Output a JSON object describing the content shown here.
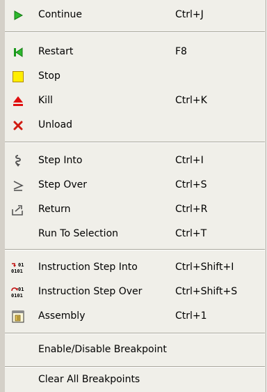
{
  "menu": {
    "items": [
      {
        "label": "Continue",
        "accel": "Ctrl+J",
        "icon": "play-icon"
      },
      {
        "label": "Restart",
        "accel": "F8",
        "icon": "restart-icon"
      },
      {
        "label": "Stop",
        "accel": "",
        "icon": "stop-icon"
      },
      {
        "label": "Kill",
        "accel": "Ctrl+K",
        "icon": "eject-icon"
      },
      {
        "label": "Unload",
        "accel": "",
        "icon": "unload-x-icon"
      },
      {
        "label": "Step Into",
        "accel": "Ctrl+I",
        "icon": "step-into-icon"
      },
      {
        "label": "Step Over",
        "accel": "Ctrl+S",
        "icon": "step-over-icon"
      },
      {
        "label": "Return",
        "accel": "Ctrl+R",
        "icon": "return-icon"
      },
      {
        "label": "Run To Selection",
        "accel": "Ctrl+T",
        "icon": ""
      },
      {
        "label": "Instruction Step Into",
        "accel": "Ctrl+Shift+I",
        "icon": "binary-step-into-icon"
      },
      {
        "label": "Instruction Step Over",
        "accel": "Ctrl+Shift+S",
        "icon": "binary-step-over-icon"
      },
      {
        "label": "Assembly",
        "accel": "Ctrl+1",
        "icon": "assembly-window-icon"
      },
      {
        "label": "Enable/Disable Breakpoint",
        "accel": "",
        "icon": ""
      },
      {
        "label": "Clear All Breakpoints",
        "accel": "",
        "icon": ""
      }
    ]
  },
  "icon_text": {
    "binary_top": "01",
    "binary_bottom": "0101"
  },
  "colors": {
    "menu_background": "#f0efe9",
    "gutter": "#d4d0c8",
    "separator": "#a8a69c",
    "play_green": "#2db82d",
    "stop_yellow": "#ffee00",
    "kill_red": "#e01010"
  }
}
